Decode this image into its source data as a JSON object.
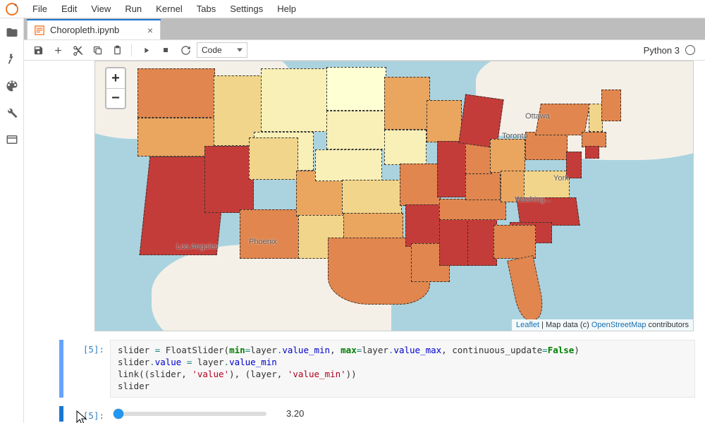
{
  "menubar": {
    "items": [
      "File",
      "Edit",
      "View",
      "Run",
      "Kernel",
      "Tabs",
      "Settings",
      "Help"
    ]
  },
  "sidebar": {
    "icons": [
      "folder",
      "running",
      "palette",
      "wrench",
      "panel"
    ]
  },
  "tab": {
    "title": "Choropleth.ipynb"
  },
  "toolbar": {
    "celltype": "Code",
    "kernel": "Python 3"
  },
  "map": {
    "attribution_leaflet": "Leaflet",
    "attribution_mid": " | Map data (c) ",
    "attribution_osm": "OpenStreetMap",
    "attribution_tail": " contributors",
    "cities": {
      "los_angeles": "Los Angeles",
      "phoenix": "Phoenix",
      "toronto": "Toronto",
      "ottawa": "Ottawa",
      "new_york": "York",
      "washington": "Washing..."
    },
    "zoom_in": "+",
    "zoom_out": "−"
  },
  "cells": {
    "in5": {
      "prompt": "[5]:",
      "line1a": "slider ",
      "line1_op": "=",
      "line1b": " FloatSlider(",
      "line1_min": "min",
      "line1_eq1": "=",
      "line1c": "layer",
      "line1_dot1": ".",
      "line1_vmin": "value_min",
      "line1_comma1": ", ",
      "line1_max": "max",
      "line1_eq2": "=",
      "line1d": "layer",
      "line1_dot2": ".",
      "line1_vmax": "value_max",
      "line1_comma2": ", continuous_update",
      "line1_eq3": "=",
      "line1_false": "False",
      "line1_close": ")",
      "line2a": "slider",
      "line2_dot": ".",
      "line2_val": "value",
      "line2_eq": " = ",
      "line2b": "layer",
      "line2_dot2": ".",
      "line2_vmin": "value_min",
      "line3a": "link((slider, ",
      "line3_s1": "'value'",
      "line3b": "), (layer, ",
      "line3_s2": "'value_min'",
      "line3c": "))",
      "line4": "slider"
    },
    "out5": {
      "prompt": "[5]:",
      "value": "3.20"
    }
  }
}
